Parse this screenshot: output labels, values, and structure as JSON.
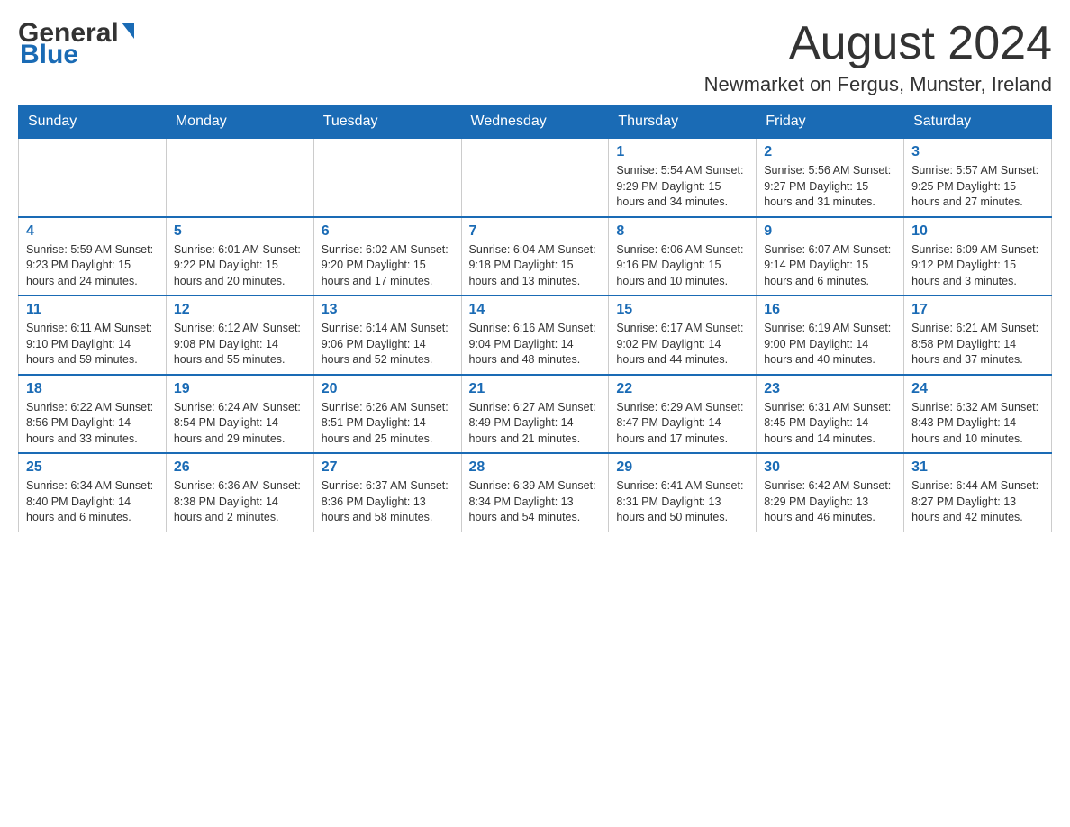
{
  "header": {
    "logo_general": "General",
    "logo_blue": "Blue",
    "month_title": "August 2024",
    "location": "Newmarket on Fergus, Munster, Ireland"
  },
  "days_of_week": [
    "Sunday",
    "Monday",
    "Tuesday",
    "Wednesday",
    "Thursday",
    "Friday",
    "Saturday"
  ],
  "weeks": [
    [
      {
        "day": "",
        "info": ""
      },
      {
        "day": "",
        "info": ""
      },
      {
        "day": "",
        "info": ""
      },
      {
        "day": "",
        "info": ""
      },
      {
        "day": "1",
        "info": "Sunrise: 5:54 AM\nSunset: 9:29 PM\nDaylight: 15 hours and 34 minutes."
      },
      {
        "day": "2",
        "info": "Sunrise: 5:56 AM\nSunset: 9:27 PM\nDaylight: 15 hours and 31 minutes."
      },
      {
        "day": "3",
        "info": "Sunrise: 5:57 AM\nSunset: 9:25 PM\nDaylight: 15 hours and 27 minutes."
      }
    ],
    [
      {
        "day": "4",
        "info": "Sunrise: 5:59 AM\nSunset: 9:23 PM\nDaylight: 15 hours and 24 minutes."
      },
      {
        "day": "5",
        "info": "Sunrise: 6:01 AM\nSunset: 9:22 PM\nDaylight: 15 hours and 20 minutes."
      },
      {
        "day": "6",
        "info": "Sunrise: 6:02 AM\nSunset: 9:20 PM\nDaylight: 15 hours and 17 minutes."
      },
      {
        "day": "7",
        "info": "Sunrise: 6:04 AM\nSunset: 9:18 PM\nDaylight: 15 hours and 13 minutes."
      },
      {
        "day": "8",
        "info": "Sunrise: 6:06 AM\nSunset: 9:16 PM\nDaylight: 15 hours and 10 minutes."
      },
      {
        "day": "9",
        "info": "Sunrise: 6:07 AM\nSunset: 9:14 PM\nDaylight: 15 hours and 6 minutes."
      },
      {
        "day": "10",
        "info": "Sunrise: 6:09 AM\nSunset: 9:12 PM\nDaylight: 15 hours and 3 minutes."
      }
    ],
    [
      {
        "day": "11",
        "info": "Sunrise: 6:11 AM\nSunset: 9:10 PM\nDaylight: 14 hours and 59 minutes."
      },
      {
        "day": "12",
        "info": "Sunrise: 6:12 AM\nSunset: 9:08 PM\nDaylight: 14 hours and 55 minutes."
      },
      {
        "day": "13",
        "info": "Sunrise: 6:14 AM\nSunset: 9:06 PM\nDaylight: 14 hours and 52 minutes."
      },
      {
        "day": "14",
        "info": "Sunrise: 6:16 AM\nSunset: 9:04 PM\nDaylight: 14 hours and 48 minutes."
      },
      {
        "day": "15",
        "info": "Sunrise: 6:17 AM\nSunset: 9:02 PM\nDaylight: 14 hours and 44 minutes."
      },
      {
        "day": "16",
        "info": "Sunrise: 6:19 AM\nSunset: 9:00 PM\nDaylight: 14 hours and 40 minutes."
      },
      {
        "day": "17",
        "info": "Sunrise: 6:21 AM\nSunset: 8:58 PM\nDaylight: 14 hours and 37 minutes."
      }
    ],
    [
      {
        "day": "18",
        "info": "Sunrise: 6:22 AM\nSunset: 8:56 PM\nDaylight: 14 hours and 33 minutes."
      },
      {
        "day": "19",
        "info": "Sunrise: 6:24 AM\nSunset: 8:54 PM\nDaylight: 14 hours and 29 minutes."
      },
      {
        "day": "20",
        "info": "Sunrise: 6:26 AM\nSunset: 8:51 PM\nDaylight: 14 hours and 25 minutes."
      },
      {
        "day": "21",
        "info": "Sunrise: 6:27 AM\nSunset: 8:49 PM\nDaylight: 14 hours and 21 minutes."
      },
      {
        "day": "22",
        "info": "Sunrise: 6:29 AM\nSunset: 8:47 PM\nDaylight: 14 hours and 17 minutes."
      },
      {
        "day": "23",
        "info": "Sunrise: 6:31 AM\nSunset: 8:45 PM\nDaylight: 14 hours and 14 minutes."
      },
      {
        "day": "24",
        "info": "Sunrise: 6:32 AM\nSunset: 8:43 PM\nDaylight: 14 hours and 10 minutes."
      }
    ],
    [
      {
        "day": "25",
        "info": "Sunrise: 6:34 AM\nSunset: 8:40 PM\nDaylight: 14 hours and 6 minutes."
      },
      {
        "day": "26",
        "info": "Sunrise: 6:36 AM\nSunset: 8:38 PM\nDaylight: 14 hours and 2 minutes."
      },
      {
        "day": "27",
        "info": "Sunrise: 6:37 AM\nSunset: 8:36 PM\nDaylight: 13 hours and 58 minutes."
      },
      {
        "day": "28",
        "info": "Sunrise: 6:39 AM\nSunset: 8:34 PM\nDaylight: 13 hours and 54 minutes."
      },
      {
        "day": "29",
        "info": "Sunrise: 6:41 AM\nSunset: 8:31 PM\nDaylight: 13 hours and 50 minutes."
      },
      {
        "day": "30",
        "info": "Sunrise: 6:42 AM\nSunset: 8:29 PM\nDaylight: 13 hours and 46 minutes."
      },
      {
        "day": "31",
        "info": "Sunrise: 6:44 AM\nSunset: 8:27 PM\nDaylight: 13 hours and 42 minutes."
      }
    ]
  ]
}
